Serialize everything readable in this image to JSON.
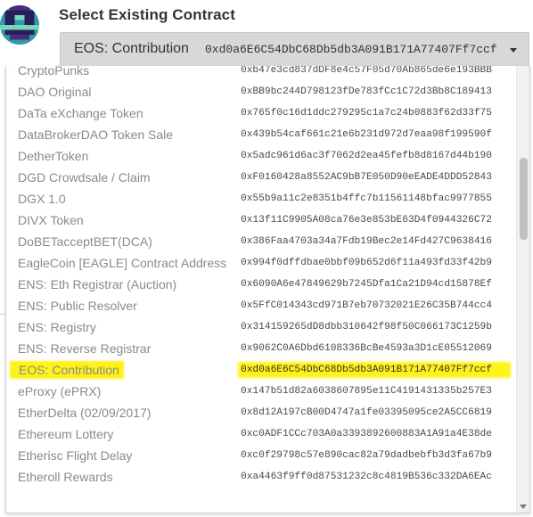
{
  "header": {
    "title": "Select Existing Contract"
  },
  "selected": {
    "name": "EOS: Contribution",
    "address": "0xd0a6E6C54DbC68Db5db3A091B171A77407Ff7ccf"
  },
  "dropdown": {
    "items": [
      {
        "name": "CryptoPunks",
        "address": "0xb47e3cd837dDF8e4c57F05d70Ab865de6e193BBB"
      },
      {
        "name": "DAO Original",
        "address": "0xBB9bc244D798123fDe783fCc1C72d3Bb8C189413"
      },
      {
        "name": "DaTa eXchange Token",
        "address": "0x765f0c16d1ddc279295c1a7c24b0883f62d33f75"
      },
      {
        "name": "DataBrokerDAO Token Sale",
        "address": "0x439b54caf661c21e6b231d972d7eaa98f199590f"
      },
      {
        "name": "DetherToken",
        "address": "0x5adc961d6ac3f7062d2ea45fefb8d8167d44b190"
      },
      {
        "name": "DGD Crowdsale / Claim",
        "address": "0xF0160428a8552AC9bB7E050D90eEADE4DDD52843"
      },
      {
        "name": "DGX 1.0",
        "address": "0x55b9a11c2e8351b4ffc7b11561148bfac9977855"
      },
      {
        "name": "DIVX Token",
        "address": "0x13f11C9905A08ca76e3e853bE63D4f0944326C72"
      },
      {
        "name": "DoBETacceptBET(DCA)",
        "address": "0x386Faa4703a34a7Fdb19Bec2e14Fd427C9638416"
      },
      {
        "name": "EagleCoin [EAGLE] Contract Address",
        "address": "0x994f0dffdbae0bbf09b652d6f11a493fd33f42b9"
      },
      {
        "name": "ENS: Eth Registrar (Auction)",
        "address": "0x6090A6e47849629b7245Dfa1Ca21D94cd15878Ef"
      },
      {
        "name": "ENS: Public Resolver",
        "address": "0x5FfC014343cd971B7eb70732021E26C35B744cc4"
      },
      {
        "name": "ENS: Registry",
        "address": "0x314159265dD8dbb310642f98f50C066173C1259b"
      },
      {
        "name": "ENS: Reverse Registrar",
        "address": "0x9062C0A6Dbd6108336BcBe4593a3D1cE05512069"
      },
      {
        "name": "EOS: Contribution",
        "address": "0xd0a6E6C54DbC68Db5db3A091B171A77407Ff7ccf",
        "highlighted": true
      },
      {
        "name": "eProxy (ePRX)",
        "address": "0x147b51d82a6038607895e11C4191431335b257E3"
      },
      {
        "name": "EtherDelta (02/09/2017)",
        "address": "0x8d12A197cB00D4747a1fe03395095ce2A5CC6819"
      },
      {
        "name": "Ethereum Lottery",
        "address": "0xc0ADF1CCc703A0a3393892600883A1A91a4E38de"
      },
      {
        "name": "Etherisc Flight Delay",
        "address": "0xc0f29798c57e890cac82a79dadbebfb3d3fa67b9"
      },
      {
        "name": "Etheroll Rewards",
        "address": "0xa4463f9ff0d87531232c8c4819B536c332DA6EAc"
      },
      {
        "name": "",
        "address": ""
      }
    ]
  },
  "colors": {
    "highlight": "#fff21a",
    "select_bg": "#d8d8d8"
  },
  "icons": {
    "avatar": "identicon-avatar",
    "caret": "caret-down-icon"
  }
}
